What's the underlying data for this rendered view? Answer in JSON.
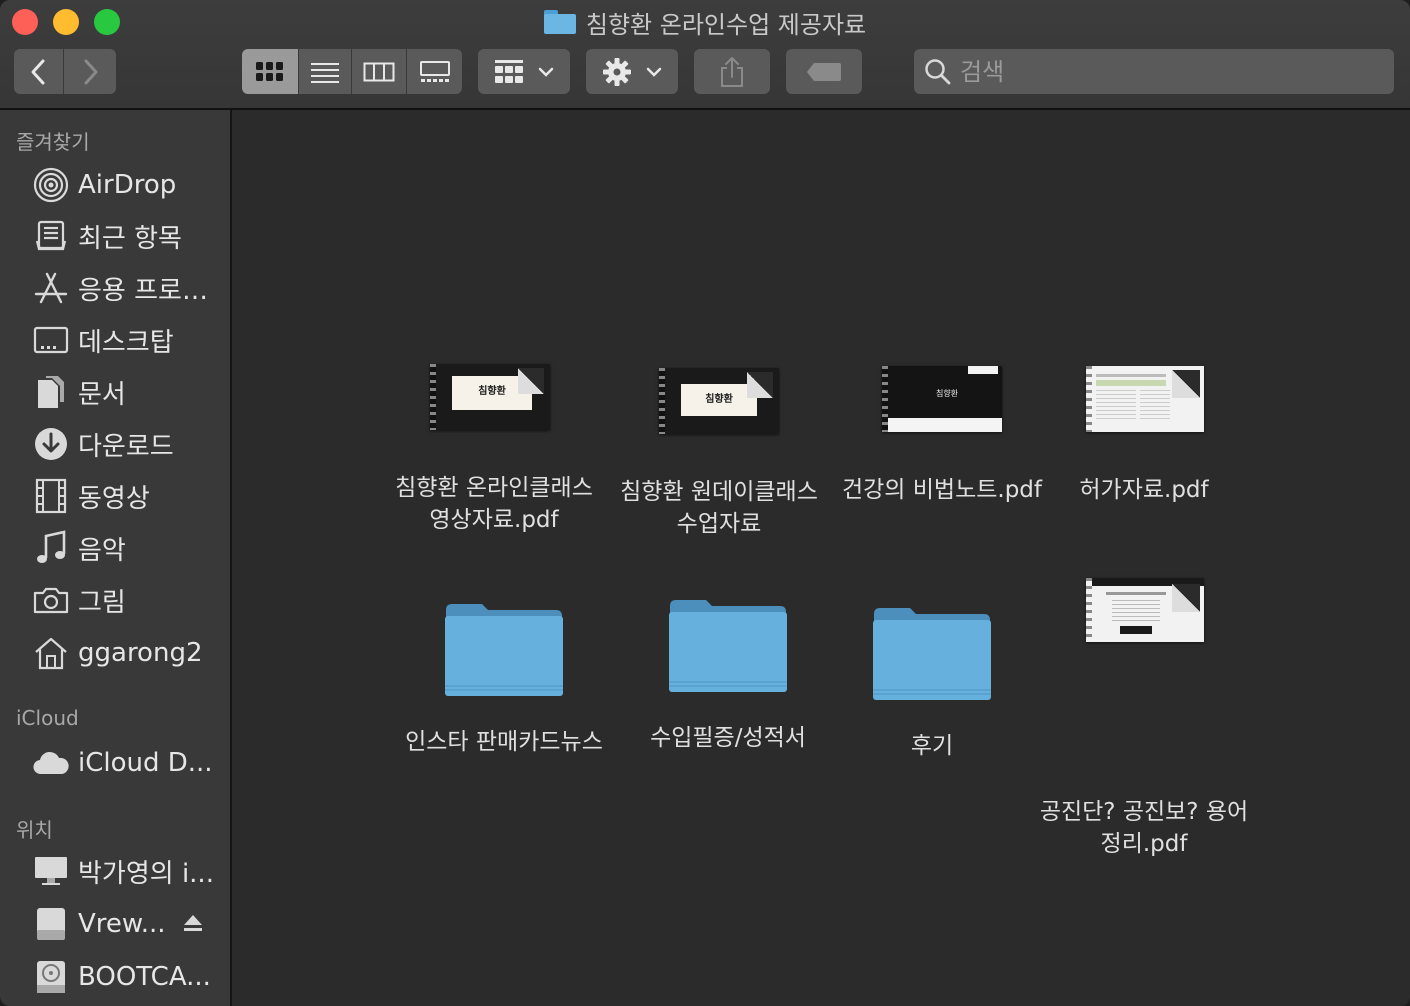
{
  "window": {
    "title": "침향환 온라인수업 제공자료"
  },
  "toolbar": {
    "back_icon": "chevron-left-icon",
    "forward_icon": "chevron-right-icon",
    "view_modes": [
      "icon",
      "list",
      "column",
      "gallery"
    ],
    "active_view": "icon",
    "search_placeholder": "검색"
  },
  "sidebar": {
    "favorites_title": "즐겨찾기",
    "favorites": [
      {
        "label": "AirDrop",
        "icon": "airdrop-icon"
      },
      {
        "label": "최근 항목",
        "icon": "recents-icon"
      },
      {
        "label": "응용 프로…",
        "icon": "applications-icon"
      },
      {
        "label": "데스크탑",
        "icon": "desktop-icon"
      },
      {
        "label": "문서",
        "icon": "documents-icon"
      },
      {
        "label": "다운로드",
        "icon": "downloads-icon"
      },
      {
        "label": "동영상",
        "icon": "movies-icon"
      },
      {
        "label": "음악",
        "icon": "music-icon"
      },
      {
        "label": "그림",
        "icon": "pictures-icon"
      },
      {
        "label": "ggarong2",
        "icon": "home-icon"
      }
    ],
    "icloud_title": "iCloud",
    "icloud": [
      {
        "label": "iCloud D...",
        "icon": "cloud-icon"
      }
    ],
    "locations_title": "위치",
    "locations": [
      {
        "label": "박가영의 i...",
        "icon": "computer-icon"
      },
      {
        "label": "Vrew...",
        "icon": "drive-icon",
        "eject_icon": "eject-icon"
      },
      {
        "label": "BOOTCA...",
        "icon": "disk-icon"
      }
    ]
  },
  "files": [
    {
      "name_line1": "침향환 온라인클래스",
      "name_line2": "영상자료.pdf",
      "type": "pdf",
      "thumb_title": "침향환"
    },
    {
      "name_line1": "침향환 원데이클래스",
      "name_line2": "수업자료",
      "type": "pdf",
      "thumb_title": "침향환"
    },
    {
      "name_line1": "건강의 비법노트.pdf",
      "name_line2": "",
      "type": "pdf",
      "thumb_title": "침향환"
    },
    {
      "name_line1": "허가자료.pdf",
      "name_line2": "",
      "type": "pdf"
    },
    {
      "name_line1": "인스타 판매카드뉴스",
      "name_line2": "",
      "type": "folder"
    },
    {
      "name_line1": "수입필증/성적서",
      "name_line2": "",
      "type": "folder"
    },
    {
      "name_line1": "후기",
      "name_line2": "",
      "type": "folder"
    },
    {
      "name_line1": "공진단? 공진보? 용어",
      "name_line2": "정리.pdf",
      "type": "pdf"
    }
  ]
}
